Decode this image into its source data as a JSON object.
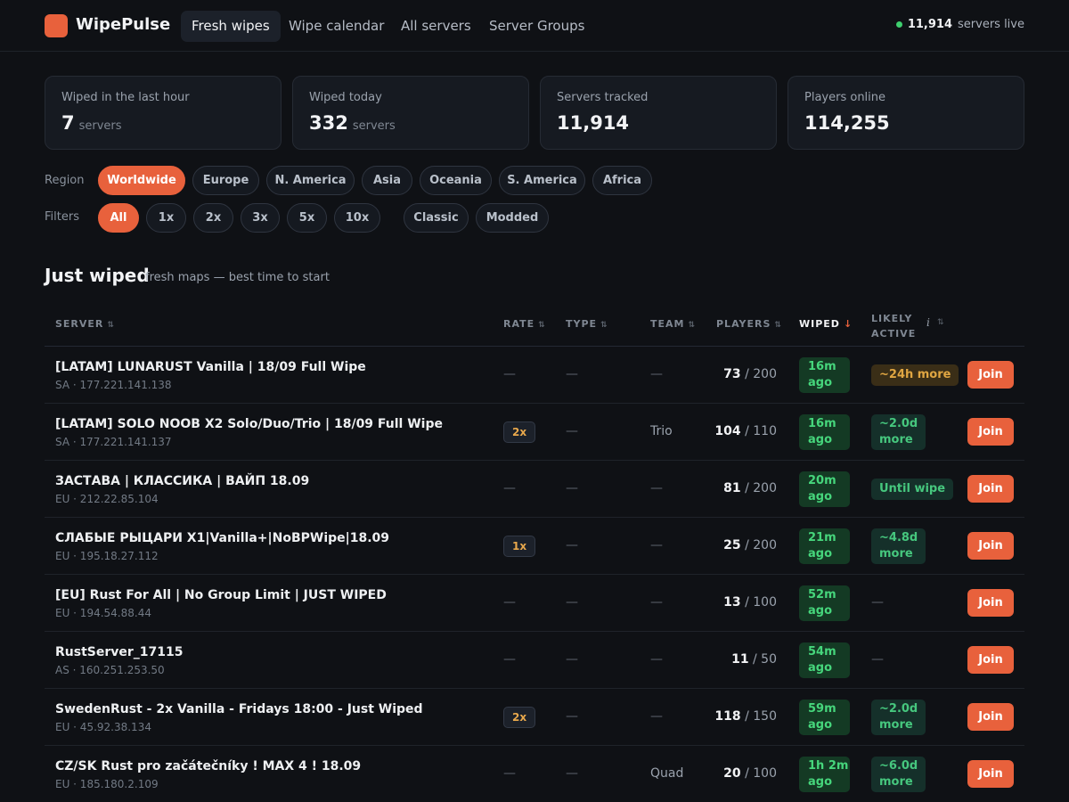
{
  "app": {
    "name": "WipePulse"
  },
  "nav": {
    "tabs": [
      {
        "label": "Fresh wipes",
        "active": true
      },
      {
        "label": "Wipe calendar"
      },
      {
        "label": "All servers"
      },
      {
        "label": "Server Groups"
      }
    ]
  },
  "live": {
    "count": "11,914",
    "text": "servers live",
    "dot_color": "#3ecf6e"
  },
  "stats": [
    {
      "label": "Wiped in the last hour",
      "value": "7",
      "unit": "servers"
    },
    {
      "label": "Wiped today",
      "value": "332",
      "unit": "servers"
    },
    {
      "label": "Servers tracked",
      "value": "11,914",
      "unit": ""
    },
    {
      "label": "Players online",
      "value": "114,255",
      "unit": ""
    }
  ],
  "region": {
    "label": "Region",
    "options": [
      "Worldwide",
      "Europe",
      "N. America",
      "Asia",
      "Oceania",
      "S. America",
      "Africa"
    ],
    "selected": "Worldwide"
  },
  "filters": {
    "label": "Filters",
    "rates": [
      "All",
      "1x",
      "2x",
      "3x",
      "5x",
      "10x"
    ],
    "types": [
      "Classic",
      "Modded"
    ],
    "selected": "All"
  },
  "section": {
    "title": "Just wiped",
    "subtitle": "fresh maps — best time to start"
  },
  "table": {
    "headers": {
      "server": "Server",
      "rate": "Rate",
      "type": "Type",
      "team": "Team",
      "players": "Players",
      "wiped": "Wiped",
      "likely_active_1": "Likely",
      "likely_active_2": "Active"
    },
    "empty": "—",
    "join_label": "Join",
    "rows": [
      {
        "name": "[LATAM] LUNARUST Vanilla | 18/09 Full Wipe",
        "addr": "SA · 177.221.141.138",
        "rate": "",
        "team": "",
        "players": "73",
        "max": "/ 200",
        "wiped_1": "16m",
        "wiped_2": "ago",
        "active_1": "~24h more",
        "active_2": "",
        "active_style": "amber"
      },
      {
        "name": "[LATAM] SOLO NOOB X2 Solo/Duo/Trio | 18/09 Full Wipe",
        "addr": "SA · 177.221.141.137",
        "rate": "2x",
        "team": "Trio",
        "players": "104",
        "max": "/ 110",
        "wiped_1": "16m",
        "wiped_2": "ago",
        "active_1": "~2.0d",
        "active_2": "more",
        "active_style": "green"
      },
      {
        "name": "ЗАСТАВА | КЛАССИКА | ВАЙП 18.09",
        "addr": "EU · 212.22.85.104",
        "rate": "",
        "team": "",
        "players": "81",
        "max": "/ 200",
        "wiped_1": "20m",
        "wiped_2": "ago",
        "active_1": "Until wipe",
        "active_2": "",
        "active_style": "green"
      },
      {
        "name": "СЛАБЫЕ РЫЦАРИ X1|Vanilla+|NoBPWipe|18.09",
        "addr": "EU · 195.18.27.112",
        "rate": "1x",
        "team": "",
        "players": "25",
        "max": "/ 200",
        "wiped_1": "21m",
        "wiped_2": "ago",
        "active_1": "~4.8d",
        "active_2": "more",
        "active_style": "green"
      },
      {
        "name": "[EU] Rust For All | No Group Limit | JUST WIPED",
        "addr": "EU · 194.54.88.44",
        "rate": "",
        "team": "",
        "players": "13",
        "max": "/ 100",
        "wiped_1": "52m",
        "wiped_2": "ago",
        "active_1": "",
        "active_2": "",
        "active_style": "none"
      },
      {
        "name": "RustServer_17115",
        "addr": "AS · 160.251.253.50",
        "rate": "",
        "team": "",
        "players": "11",
        "max": "/ 50",
        "wiped_1": "54m",
        "wiped_2": "ago",
        "active_1": "",
        "active_2": "",
        "active_style": "none"
      },
      {
        "name": "SwedenRust - 2x Vanilla - Fridays 18:00 - Just Wiped",
        "addr": "EU · 45.92.38.134",
        "rate": "2x",
        "team": "",
        "players": "118",
        "max": "/ 150",
        "wiped_1": "59m",
        "wiped_2": "ago",
        "active_1": "~2.0d",
        "active_2": "more",
        "active_style": "green"
      },
      {
        "name": "CZ/SK Rust pro začátečníky ! MAX 4 ! 18.09",
        "addr": "EU · 185.180.2.109",
        "rate": "",
        "team": "Quad",
        "players": "20",
        "max": "/ 100",
        "wiped_1": "1h 2m",
        "wiped_2": "ago",
        "active_1": "~6.0d",
        "active_2": "more",
        "active_style": "green"
      }
    ]
  },
  "colors": {
    "accent": "#e8613c",
    "background": "#0f1115",
    "wiped_green": "#46d67c",
    "active_amber": "#e0a642"
  }
}
